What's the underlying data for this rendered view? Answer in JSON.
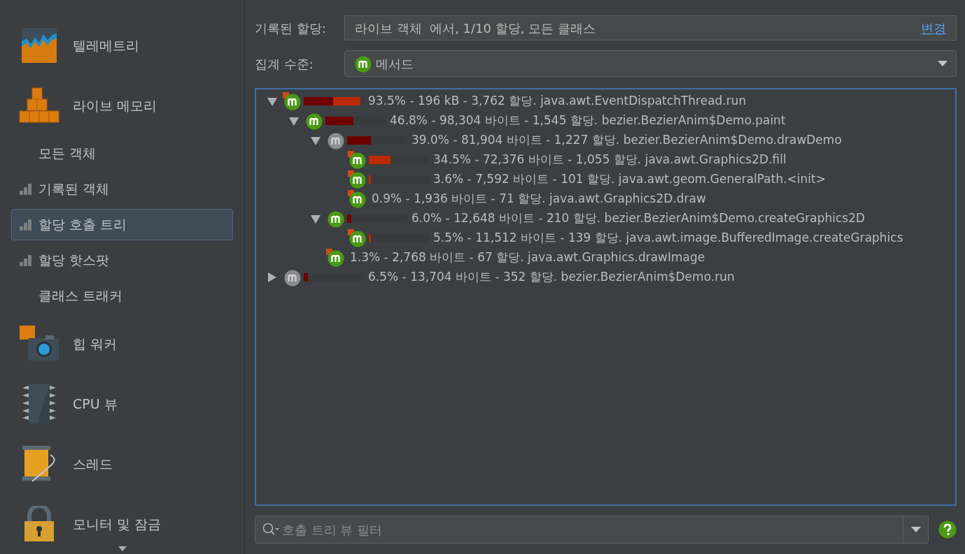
{
  "sidebar": {
    "items": [
      {
        "kind": "telemetry",
        "label": "텔레메트리"
      },
      {
        "kind": "live_memory",
        "label": "라이브 메모리"
      },
      {
        "kind": "view",
        "label": "모든 객체",
        "recording": false,
        "selected": false
      },
      {
        "kind": "view",
        "label": "기록된 객체",
        "recording": true,
        "selected": false
      },
      {
        "kind": "view",
        "label": "할당 호출 트리",
        "recording": true,
        "selected": true
      },
      {
        "kind": "view",
        "label": "할당 핫스팟",
        "recording": true,
        "selected": false
      },
      {
        "kind": "view",
        "label": "클래스 트래커",
        "recording": false,
        "selected": false
      },
      {
        "kind": "heap_walker",
        "label": "힙 워커"
      },
      {
        "kind": "cpu",
        "label": "CPU 뷰"
      },
      {
        "kind": "threads",
        "label": "스레드"
      },
      {
        "kind": "monitors",
        "label": "모니터 및 잠금"
      }
    ]
  },
  "recorded": {
    "label": "기록된 할당:",
    "value": "라이브 객체  에서, 1/10 할당, 모든 클래스",
    "link": "변경"
  },
  "aggregation": {
    "label": "집계 수준:",
    "value": "메서드"
  },
  "tree": [
    {
      "text": "93.5% - 196 kB - 3,762 할당. java.awt.EventDispatchThread.run",
      "kind": "green",
      "hot": true,
      "expanded": true,
      "bars": [
        {
          "kind": "total",
          "level": 0.49
        },
        {
          "kind": "self",
          "level": 0.45
        }
      ],
      "children": [
        {
          "text": "46.8% - 98,304 바이트 - 1,545 할당. bezier.BezierAnim$Demo.paint",
          "kind": "green",
          "hot": false,
          "expanded": true,
          "bars": [
            {
              "kind": "total",
              "level": 0.47
            }
          ],
          "children": [
            {
              "text": "39.0% - 81,904 바이트 - 1,227 할당. bezier.BezierAnim$Demo.drawDemo",
              "kind": "gray",
              "hot": false,
              "expanded": true,
              "bars": [
                {
                  "kind": "total",
                  "level": 0.4
                }
              ],
              "children": [
                {
                  "text": "34.5% - 72,376 바이트 - 1,055 할당. java.awt.Graphics2D.fill",
                  "kind": "green",
                  "hot": true,
                  "bars": [
                    {
                      "kind": "self",
                      "level": 0.36
                    }
                  ]
                },
                {
                  "text": "3.6% - 7,592 바이트 - 101 할당. java.awt.geom.GeneralPath.<init>",
                  "kind": "green",
                  "hot": true,
                  "bars": [
                    {
                      "kind": "self",
                      "level": 0.04
                    }
                  ]
                },
                {
                  "text": "0.9% - 1,936 바이트 - 71 할당. java.awt.Graphics2D.draw",
                  "kind": "green",
                  "hot": true
                }
              ]
            },
            {
              "text": "6.0% - 12,648 바이트 - 210 할당. bezier.BezierAnim$Demo.createGraphics2D",
              "kind": "green",
              "hot": false,
              "expanded": true,
              "bars": [
                {
                  "kind": "total",
                  "level": 0.07
                }
              ],
              "children": [
                {
                  "text": "5.5% - 11,512 바이트 - 139 할당. java.awt.image.BufferedImage.createGraphics",
                  "kind": "green",
                  "hot": true,
                  "bars": [
                    {
                      "kind": "self",
                      "level": 0.04
                    }
                  ]
                }
              ]
            },
            {
              "text": "1.3% - 2,768 바이트 - 67 할당. java.awt.Graphics.drawImage",
              "kind": "green",
              "hot": true
            }
          ]
        }
      ]
    },
    {
      "text": "6.5% - 13,704 바이트 - 352 할당. bezier.BezierAnim$Demo.run",
      "kind": "gray",
      "hot": false,
      "expanded": false,
      "bars": [
        {
          "kind": "total",
          "level": 0.07
        }
      ]
    }
  ],
  "filter": {
    "placeholder": "호출 트리 뷰 필터"
  }
}
